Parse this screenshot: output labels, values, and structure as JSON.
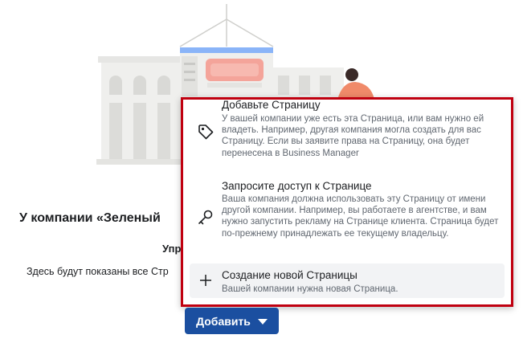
{
  "page": {
    "heading": "У компании «Зеленый",
    "subheading": "Упр",
    "description": "Здесь будут показаны все Стр"
  },
  "menu": {
    "items": [
      {
        "icon": "tag-icon",
        "title": "Добавьте Страницу",
        "text": "У вашей компании уже есть эта Страница, или вам нужно ей владеть. Например, другая компания могла создать для вас Страницу. Если вы заявите права на Страницу, она будет перенесена в Business Manager"
      },
      {
        "icon": "key-icon",
        "title": "Запросите доступ к Странице",
        "text": "Ваша компания должна использовать эту Страницу от имени другой компании. Например, вы работаете в агентстве, и вам нужно запустить рекламу на Странице клиента. Страница будет по-прежнему принадлежать ее текущему владельцу."
      },
      {
        "icon": "plus-icon",
        "title": "Создание новой Страницы",
        "text": "Вашей компании нужна новая Страница."
      }
    ]
  },
  "add_button": {
    "label": "Добавить",
    "icon": "caret-down-icon"
  },
  "colors": {
    "button_bg": "#1b4fa0",
    "highlight_border": "#c00010",
    "roof_accent": "#8ab4f8",
    "sign": "#f4a49a",
    "person_shirt": "#f08a6a"
  }
}
